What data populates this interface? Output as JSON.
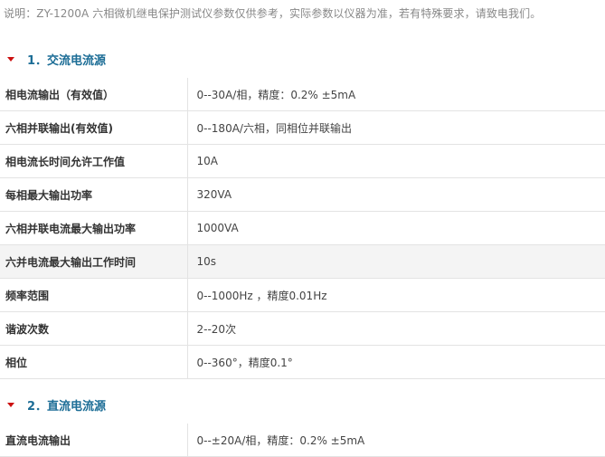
{
  "note": "说明：ZY-1200A 六相微机继电保护测试仪参数仅供参考，实际参数以仪器为准，若有特殊要求，请致电我们。",
  "sections": [
    {
      "title": "1．交流电流源",
      "rows": [
        {
          "key": "相电流输出（有效值）",
          "value": "0--30A/相，精度：0.2%  ±5mA"
        },
        {
          "key": "六相并联输出(有效值)",
          "value": "0--180A/六相，同相位并联输出"
        },
        {
          "key": "相电流长时间允许工作值",
          "value": "10A"
        },
        {
          "key": "每相最大输出功率",
          "value": "320VA"
        },
        {
          "key": "六相并联电流最大输出功率",
          "value": "1000VA"
        },
        {
          "key": "六并电流最大输出工作时间",
          "value": "10s"
        },
        {
          "key": "频率范围",
          "value": "0--1000Hz ，精度0.01Hz"
        },
        {
          "key": "谐波次数",
          "value": "2--20次"
        },
        {
          "key": "相位",
          "value": "0--360°，精度0.1°"
        }
      ]
    },
    {
      "title": "2．直流电流源",
      "rows": [
        {
          "key": "直流电流输出",
          "value": "0--±20A/相，精度：0.2%  ±5mA"
        }
      ]
    }
  ],
  "colors": {
    "section_title": "#1c6d96",
    "arrow": "#cc1111",
    "highlight_row": "#f4f4f4"
  }
}
